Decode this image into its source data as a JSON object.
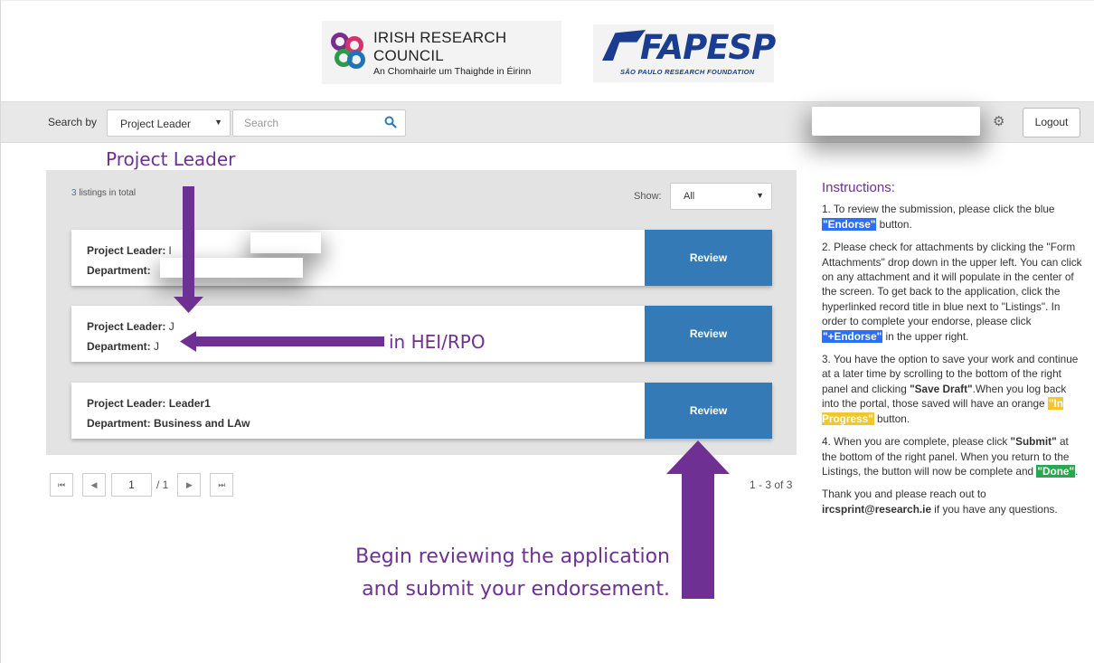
{
  "header": {
    "irc_logo": {
      "line1": "IRISH RESEARCH COUNCIL",
      "line2": "An Chomhairle um Thaighde in Éirinn"
    },
    "fapesp_logo": {
      "word": "FAPESP",
      "subtitle": "SÃO PAULO RESEARCH FOUNDATION"
    }
  },
  "toolbar": {
    "search_by_label": "Search by",
    "search_by_value": "Project Leader",
    "search_placeholder": "Search",
    "logout_label": "Logout",
    "icons": [
      "search-icon",
      "gear-icon",
      "caret-down-icon"
    ]
  },
  "listings": {
    "count": "3",
    "count_suffix": " listings in total",
    "show_label": "Show:",
    "show_value": "All",
    "items": [
      {
        "leader_label": "Project Leader:",
        "leader_value": "l",
        "dept_label": "Department:",
        "dept_value": "",
        "review_label": "Review"
      },
      {
        "leader_label": "Project Leader:",
        "leader_value": "J",
        "dept_label": "Department:",
        "dept_value": "J",
        "review_label": "Review"
      },
      {
        "leader_label": "Project Leader:",
        "leader_value": "Leader1",
        "dept_label": "Department:",
        "dept_value": "Business and LAw",
        "review_label": "Review"
      }
    ]
  },
  "pagination": {
    "first": "⏮",
    "prev": "◀",
    "page": "1",
    "total": "/ 1",
    "next": "▶",
    "last": "⏭",
    "range": "1 - 3 of 3"
  },
  "instructions": {
    "title": "Instructions:",
    "p1_a": "1. To review the submission, please click the blue ",
    "p1_hl": "\"Endorse\"",
    "p1_b": " button.",
    "p2_a": "2. Please check for attachments by clicking the \"Form Attachments\" drop down in the upper left. You can click on any attachment and it will populate in the center of the screen. To get back to the application, click the hyperlinked record title in blue next to \"Listings\". In order to complete your endorse, please click ",
    "p2_hl": "\"+Endorse\"",
    "p2_b": " in the upper right.",
    "p3_a": "3. You have the option to save your work and continue at a later time by scrolling to the bottom of the right panel and clicking ",
    "p3_bold": "\"Save Draft\"",
    "p3_b": ".When you log back into the portal, those saved will have an orange ",
    "p3_hl": "\"In Progress\"",
    "p3_c": " button.",
    "p4_a": "4. When you are complete, please click ",
    "p4_bold": "\"Submit\"",
    "p4_b": " at the bottom of the right panel. When you return to the Listings, the button will now be complete and ",
    "p4_hl": "\"Done\"",
    "p4_c": ".",
    "p5_a": "Thank you and please reach out to ",
    "p5_email": "ircsprint@research.ie",
    "p5_b": " if you have any questions."
  },
  "annotations": {
    "project_leader": "Project Leader",
    "hei_rpo": "in HEI/RPO",
    "begin_line1": "Begin reviewing the application",
    "begin_line2": "and submit your endorsement."
  },
  "colors": {
    "accent": "#337ab7",
    "annotation": "#6f3093",
    "highlight_blue": "#2d6ff7",
    "highlight_orange": "#f2c62f",
    "highlight_green": "#2aa74e"
  }
}
